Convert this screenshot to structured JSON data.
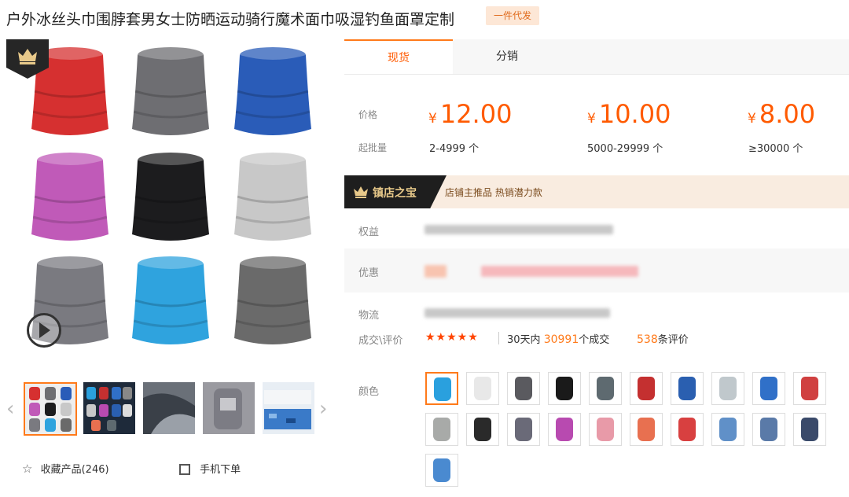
{
  "title": "户外冰丝头巾围脖套男女士防晒运动骑行魔术面巾吸湿钓鱼面罩定制",
  "badge": "一件代发",
  "tabs": [
    "现货",
    "分销"
  ],
  "price_label": "价格",
  "moq_label": "起批量",
  "currency": "¥",
  "tiers": [
    {
      "price": "12.00",
      "range": "2-4999 个"
    },
    {
      "price": "10.00",
      "range": "5000-29999 个"
    },
    {
      "price": "8.00",
      "range": "≥30000 个"
    }
  ],
  "treasure": {
    "title": "镇店之宝",
    "tags": "店铺主推品  热销潜力款"
  },
  "rows": {
    "rights": "权益",
    "discount": "优惠",
    "logistics": "物流",
    "deals": "成交\\评价"
  },
  "rating": {
    "stars": "★★★★★",
    "days": "30天内",
    "count": "30991",
    "count_suffix": "个成交",
    "reviews": "538",
    "reviews_suffix": "条评价"
  },
  "color_label": "颜色",
  "favorite": {
    "label": "收藏产品",
    "count": "(246)"
  },
  "mobile_order": "手机下单",
  "colors": {
    "accent": "#ff5a00",
    "gallery": [
      "#d63030",
      "#6e6e72",
      "#2a5cb8",
      "#c05ab8",
      "#1c1c1e",
      "#c8c8c8",
      "#7a7a80",
      "#2fa3de",
      "#6a6a6a"
    ],
    "swatches": [
      "#2aa0de",
      "#e8e8e8",
      "#5a5a5f",
      "#1a1a1a",
      "#5e6a70",
      "#c43030",
      "#2a5fb0",
      "#c0c8cc",
      "#3070c8",
      "#d04040",
      "#a8aaa8",
      "#2a2a2a",
      "#6a6a78",
      "#b84ab0",
      "#e89aa8",
      "#e87050",
      "#d84040",
      "#6090c8",
      "#5a7aa8",
      "#3a4a6a",
      "#4a8ad0"
    ]
  }
}
